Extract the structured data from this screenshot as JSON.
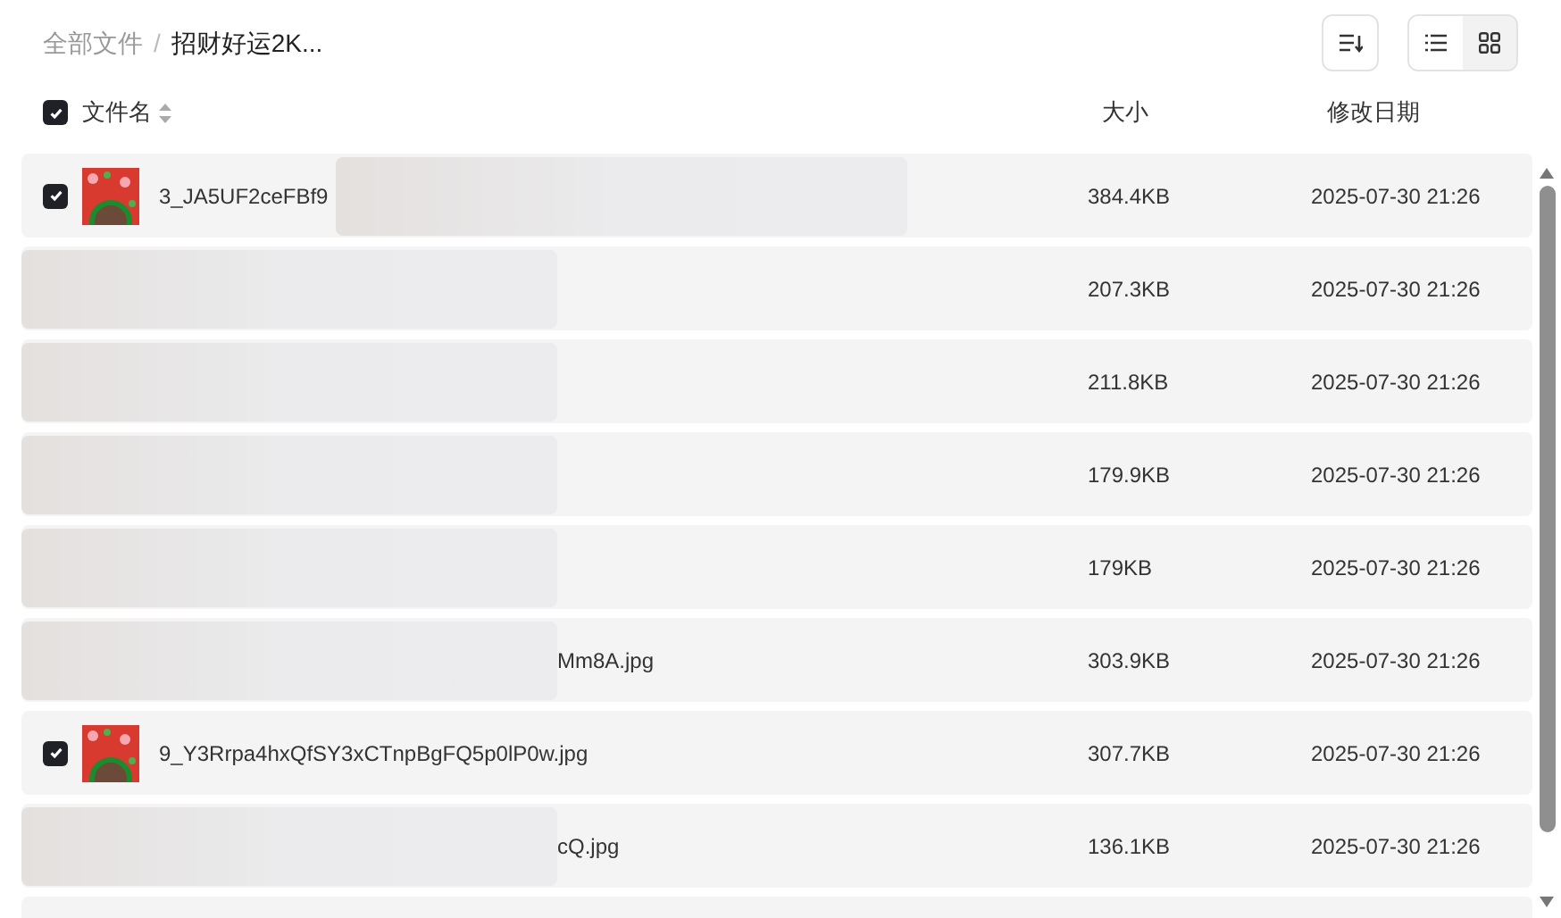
{
  "breadcrumb_separator": "/",
  "breadcrumb": [
    {
      "label": "全部文件",
      "current": false
    },
    {
      "label": "招财好运2K...",
      "current": true
    }
  ],
  "view_toggle": [
    {
      "kind": "list",
      "selected": true
    },
    {
      "kind": "grid",
      "selected": false
    }
  ],
  "header": {
    "checked": true,
    "columns": [
      "文件名",
      "大小",
      "修改日期"
    ]
  },
  "rows": [
    {
      "kind": "file",
      "checked": true,
      "name": "3_JA5UF2ceFBf9",
      "blurred": true,
      "size": "384.4KB",
      "date": "2025-07-30 21:26"
    },
    {
      "kind": "hidden",
      "size": "207.3KB",
      "date": "2025-07-30 21:26"
    },
    {
      "kind": "hidden",
      "size": "211.8KB",
      "date": "2025-07-30 21:26"
    },
    {
      "kind": "hidden",
      "size": "179.9KB",
      "date": "2025-07-30 21:26"
    },
    {
      "kind": "hidden",
      "size": "179KB",
      "date": "2025-07-30 21:26"
    },
    {
      "kind": "hidden",
      "name": "Mm8A.jpg",
      "size": "303.9KB",
      "date": "2025-07-30 21:26"
    },
    {
      "kind": "file",
      "checked": true,
      "name": "9_Y3Rrpa4hxQfSY3xCTnpBgFQ5p0lP0w.jpg",
      "blurred": false,
      "size": "307.7KB",
      "date": "2025-07-30 21:26"
    },
    {
      "kind": "hidden",
      "name": "cQ.jpg",
      "size": "136.1KB",
      "date": "2025-07-30 21:26"
    },
    {
      "kind": "empty"
    }
  ]
}
